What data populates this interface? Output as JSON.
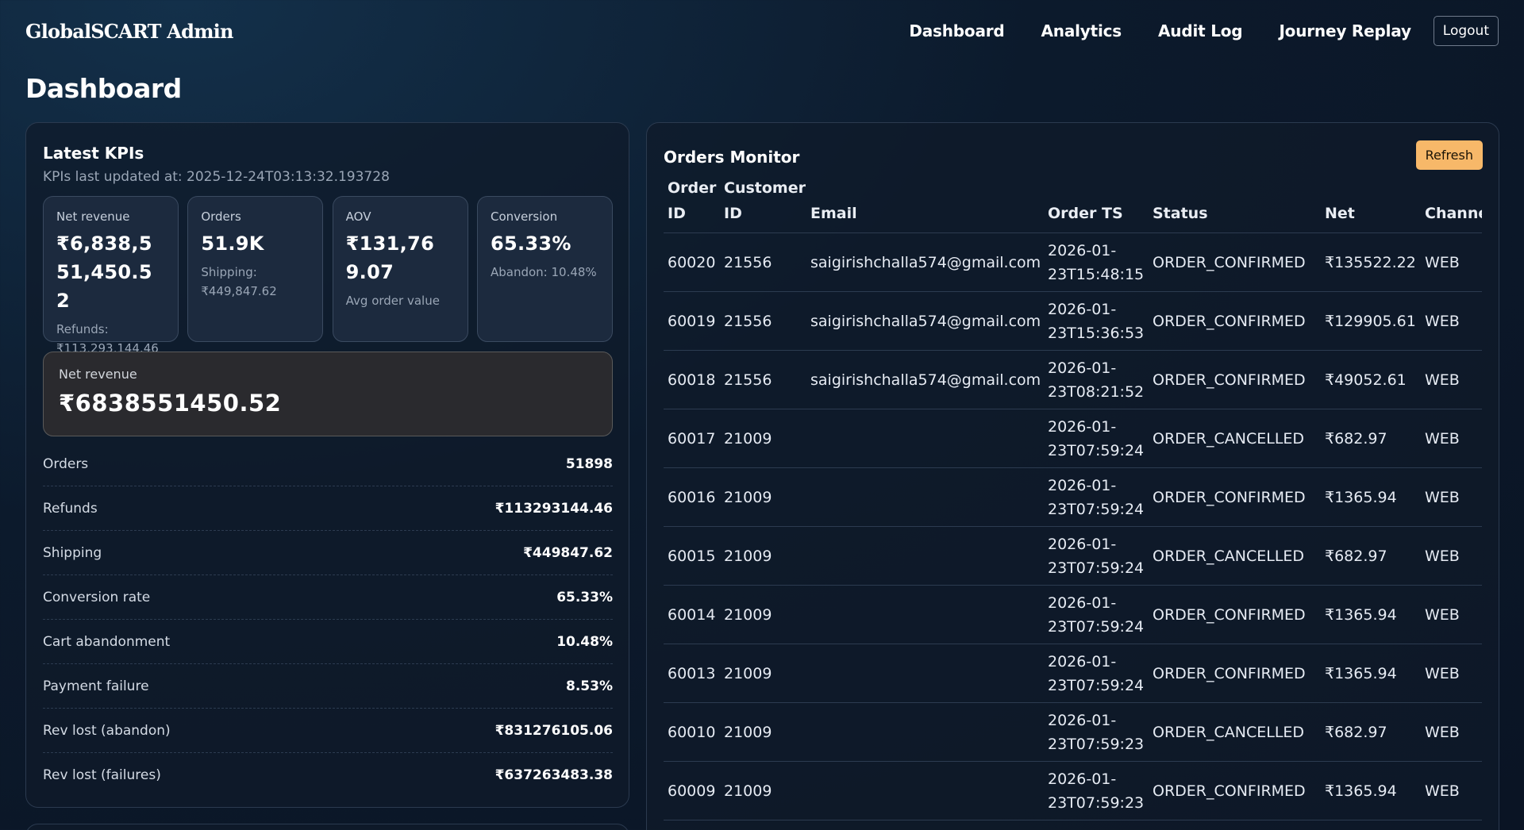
{
  "app": {
    "brand": "GlobalSCART Admin",
    "nav": [
      "Dashboard",
      "Analytics",
      "Audit Log",
      "Journey Replay"
    ],
    "logout_label": "Logout",
    "page_title": "Dashboard"
  },
  "kpis": {
    "title": "Latest KPIs",
    "updated": "KPIs last updated at: 2025-12-24T03:13:32.193728",
    "tiles": [
      {
        "label": "Net revenue",
        "value": "₹6,838,551,450.52",
        "sub": "Refunds: ₹113,293,144.46"
      },
      {
        "label": "Orders",
        "value": "51.9K",
        "sub": "Shipping: ₹449,847.62"
      },
      {
        "label": "AOV",
        "value": "₹131,769.07",
        "sub": "Avg order value"
      },
      {
        "label": "Conversion",
        "value": "65.33%",
        "sub": "Abandon: 10.48%"
      }
    ],
    "highlight": {
      "label": "Net revenue",
      "value": "₹6838551450.52"
    },
    "rows": [
      {
        "label": "Orders",
        "value": "51898"
      },
      {
        "label": "Refunds",
        "value": "₹113293144.46"
      },
      {
        "label": "Shipping",
        "value": "₹449847.62"
      },
      {
        "label": "Conversion rate",
        "value": "65.33%"
      },
      {
        "label": "Cart abandonment",
        "value": "10.48%"
      },
      {
        "label": "Payment failure",
        "value": "8.53%"
      },
      {
        "label": "Rev lost (abandon)",
        "value": "₹831276105.06"
      },
      {
        "label": "Rev lost (failures)",
        "value": "₹637263483.38"
      }
    ]
  },
  "orders": {
    "title": "Orders Monitor",
    "refresh_label": "Refresh",
    "columns": [
      "Order ID",
      "Customer ID",
      "Email",
      "Order TS",
      "Status",
      "Net",
      "Channel"
    ],
    "rows": [
      [
        "60020",
        "21556",
        "saigirishchalla574@gmail.com",
        "2026-01-23T15:48:15",
        "ORDER_CONFIRMED",
        "₹135522.22",
        "WEB"
      ],
      [
        "60019",
        "21556",
        "saigirishchalla574@gmail.com",
        "2026-01-23T15:36:53",
        "ORDER_CONFIRMED",
        "₹129905.61",
        "WEB"
      ],
      [
        "60018",
        "21556",
        "saigirishchalla574@gmail.com",
        "2026-01-23T08:21:52",
        "ORDER_CONFIRMED",
        "₹49052.61",
        "WEB"
      ],
      [
        "60017",
        "21009",
        "",
        "2026-01-23T07:59:24",
        "ORDER_CANCELLED",
        "₹682.97",
        "WEB"
      ],
      [
        "60016",
        "21009",
        "",
        "2026-01-23T07:59:24",
        "ORDER_CONFIRMED",
        "₹1365.94",
        "WEB"
      ],
      [
        "60015",
        "21009",
        "",
        "2026-01-23T07:59:24",
        "ORDER_CANCELLED",
        "₹682.97",
        "WEB"
      ],
      [
        "60014",
        "21009",
        "",
        "2026-01-23T07:59:24",
        "ORDER_CONFIRMED",
        "₹1365.94",
        "WEB"
      ],
      [
        "60013",
        "21009",
        "",
        "2026-01-23T07:59:24",
        "ORDER_CONFIRMED",
        "₹1365.94",
        "WEB"
      ],
      [
        "60010",
        "21009",
        "",
        "2026-01-23T07:59:23",
        "ORDER_CANCELLED",
        "₹682.97",
        "WEB"
      ],
      [
        "60009",
        "21009",
        "",
        "2026-01-23T07:59:23",
        "ORDER_CONFIRMED",
        "₹1365.94",
        "WEB"
      ]
    ]
  },
  "colors": {
    "accent_refresh": "#f7b869",
    "background": "#0c1a2c",
    "card_border": "#2b3a4f"
  }
}
